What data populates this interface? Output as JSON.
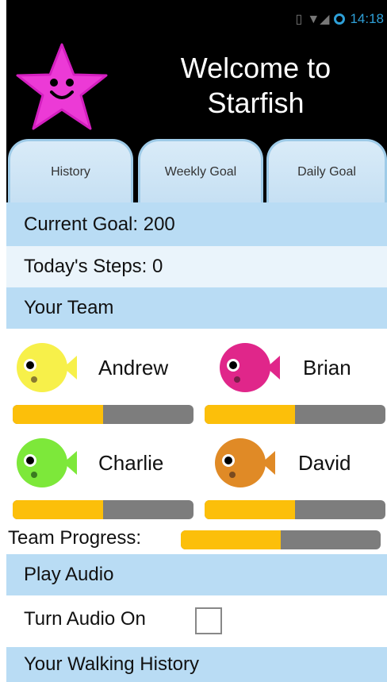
{
  "status_bar": {
    "time": "14:18"
  },
  "header": {
    "title": "Welcome to Starfish"
  },
  "tabs": [
    {
      "label": "History"
    },
    {
      "label": "Weekly Goal"
    },
    {
      "label": "Daily Goal"
    }
  ],
  "current_goal": "Current Goal: 200",
  "todays_steps": "Today's Steps: 0",
  "team": {
    "heading": "Your Team",
    "members": [
      {
        "name": "Andrew",
        "color": "#f7f04a",
        "progress": 0.5
      },
      {
        "name": "Brian",
        "color": "#e0268a",
        "progress": 0.5
      },
      {
        "name": "Charlie",
        "color": "#7de83a",
        "progress": 0.5
      },
      {
        "name": "David",
        "color": "#e08a26",
        "progress": 0.5
      }
    ]
  },
  "team_progress": {
    "label": "Team Progress:",
    "progress": 0.5
  },
  "audio": {
    "heading": "Play Audio",
    "toggle_label": "Turn Audio On",
    "checked": false
  },
  "walking_history": {
    "heading": "Your Walking History"
  },
  "colors": {
    "accent": "#fcbf0a",
    "row_blue": "#b9dcf4",
    "status": "#2ea0d8"
  }
}
